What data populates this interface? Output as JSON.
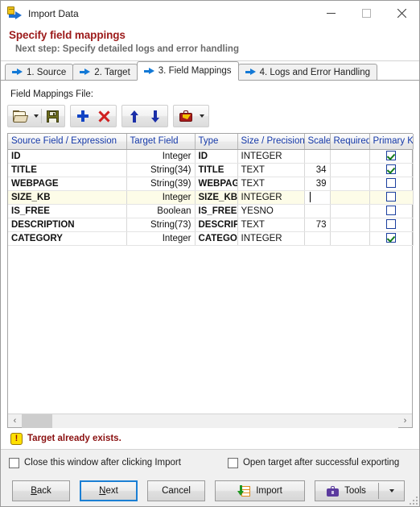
{
  "window": {
    "title": "Import Data",
    "icon": "import-data-icon",
    "minimize_label": "—",
    "maximize_label": "□",
    "close_label": "✕"
  },
  "header": {
    "title": "Specify field mappings",
    "subtitle": "Next step: Specify detailed logs and error handling",
    "title_color": "#9c1a1a",
    "subtitle_color": "#6b6b6b"
  },
  "tabs": [
    {
      "label": "1. Source",
      "active": false
    },
    {
      "label": "2. Target",
      "active": false
    },
    {
      "label": "3. Field Mappings",
      "active": true
    },
    {
      "label": "4. Logs and Error Handling",
      "active": false
    }
  ],
  "field_mappings_file": {
    "label": "Field Mappings File:"
  },
  "toolbar": {
    "open_icon": "open-folder-icon",
    "open_dropdown_icon": "chevron-down-icon",
    "save_icon": "save-floppy-icon",
    "add_icon": "plus-icon",
    "delete_icon": "red-x-icon",
    "move_up_icon": "arrow-up-icon",
    "move_down_icon": "arrow-down-icon",
    "briefcase_icon": "red-briefcase-icon",
    "briefcase_dropdown_icon": "chevron-down-icon"
  },
  "grid": {
    "columns": [
      "Source Field / Expression",
      "Target Field",
      "Type",
      "Size / Precision",
      "Scale",
      "Required",
      "Primary Ke"
    ],
    "rows": [
      {
        "source_field": "ID",
        "source_type": "Integer",
        "target_field": "ID",
        "type": "INTEGER",
        "size_precision": "",
        "scale": "",
        "required": true,
        "primary_key": true,
        "selected": false,
        "editing": false
      },
      {
        "source_field": "TITLE",
        "source_type": "String(34)",
        "target_field": "TITLE",
        "type": "TEXT",
        "size_precision": "34",
        "scale": "",
        "required": true,
        "primary_key": false,
        "selected": false,
        "editing": false
      },
      {
        "source_field": "WEBPAGE",
        "source_type": "String(39)",
        "target_field": "WEBPAGE",
        "type": "TEXT",
        "size_precision": "39",
        "scale": "",
        "required": false,
        "primary_key": false,
        "selected": false,
        "editing": false
      },
      {
        "source_field": "SIZE_KB",
        "source_type": "Integer",
        "target_field": "SIZE_KB",
        "type": "INTEGER",
        "size_precision": "",
        "scale": "",
        "required": false,
        "primary_key": false,
        "selected": true,
        "editing": true
      },
      {
        "source_field": "IS_FREE",
        "source_type": "Boolean",
        "target_field": "IS_FREE",
        "type": "YESNO",
        "size_precision": "",
        "scale": "",
        "required": false,
        "primary_key": false,
        "selected": false,
        "editing": false
      },
      {
        "source_field": "DESCRIPTION",
        "source_type": "String(73)",
        "target_field": "DESCRIPTION",
        "type": "TEXT",
        "size_precision": "73",
        "scale": "",
        "required": false,
        "primary_key": false,
        "selected": false,
        "editing": false
      },
      {
        "source_field": "CATEGORY",
        "source_type": "Integer",
        "target_field": "CATEGORY",
        "type": "INTEGER",
        "size_precision": "",
        "scale": "",
        "required": true,
        "primary_key": false,
        "selected": false,
        "editing": false
      }
    ]
  },
  "hscroll": {
    "left_arrow": "‹",
    "right_arrow": "›"
  },
  "status": {
    "icon": "warning-exclamation-icon",
    "icon_glyph": "!",
    "message": "Target already exists.",
    "color": "#8a1010"
  },
  "options": [
    {
      "label": "Close this window after clicking Import",
      "checked": false
    },
    {
      "label": "Open target after successful exporting",
      "checked": false
    }
  ],
  "buttons": {
    "back": {
      "label": "Back",
      "mnemonic": "B"
    },
    "next": {
      "label": "Next",
      "mnemonic": "N",
      "default": true
    },
    "cancel": {
      "label": "Cancel"
    },
    "import": {
      "label": "Import",
      "icon": "import-table-icon"
    },
    "tools": {
      "label": "Tools",
      "icon": "tools-briefcase-icon",
      "dropdown_icon": "chevron-down-icon"
    }
  }
}
